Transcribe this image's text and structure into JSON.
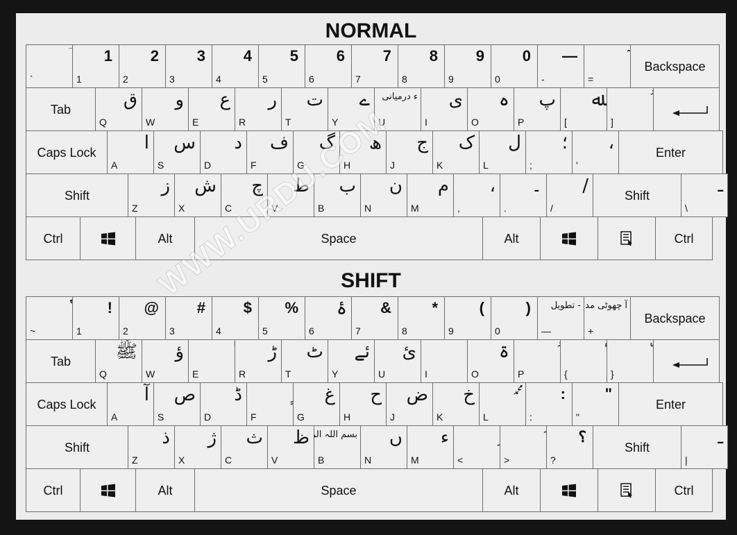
{
  "sections": [
    {
      "title": "NORMAL",
      "rows": [
        [
          {
            "name": "key-backtick",
            "latin": "`",
            "glyph": "ؔ"
          },
          {
            "name": "key-1",
            "latin": "1",
            "glyph": "1",
            "bold": true
          },
          {
            "name": "key-2",
            "latin": "2",
            "glyph": "2",
            "bold": true
          },
          {
            "name": "key-3",
            "latin": "3",
            "glyph": "3",
            "bold": true
          },
          {
            "name": "key-4",
            "latin": "4",
            "glyph": "4",
            "bold": true
          },
          {
            "name": "key-5",
            "latin": "5",
            "glyph": "5",
            "bold": true
          },
          {
            "name": "key-6",
            "latin": "6",
            "glyph": "6",
            "bold": true
          },
          {
            "name": "key-7",
            "latin": "7",
            "glyph": "7",
            "bold": true
          },
          {
            "name": "key-8",
            "latin": "8",
            "glyph": "8",
            "bold": true
          },
          {
            "name": "key-9",
            "latin": "9",
            "glyph": "9",
            "bold": true
          },
          {
            "name": "key-0",
            "latin": "0",
            "glyph": "0",
            "bold": true
          },
          {
            "name": "key-minus",
            "latin": "-",
            "glyph": "—",
            "bold": true
          },
          {
            "name": "key-equals",
            "latin": "=",
            "glyph": "ٓ"
          },
          {
            "name": "key-backspace",
            "label": "Backspace"
          }
        ],
        [
          {
            "name": "key-tab",
            "label": "Tab"
          },
          {
            "name": "key-q",
            "latin": "Q",
            "glyph": "ق"
          },
          {
            "name": "key-w",
            "latin": "W",
            "glyph": "و"
          },
          {
            "name": "key-e",
            "latin": "E",
            "glyph": "ع"
          },
          {
            "name": "key-r",
            "latin": "R",
            "glyph": "ر"
          },
          {
            "name": "key-t",
            "latin": "T",
            "glyph": "ت"
          },
          {
            "name": "key-y",
            "latin": "Y",
            "glyph": "ے"
          },
          {
            "name": "key-u",
            "latin": "U",
            "glyph": "ء درمیانی",
            "small": true
          },
          {
            "name": "key-i",
            "latin": "I",
            "glyph": "ی"
          },
          {
            "name": "key-o",
            "latin": "O",
            "glyph": "ہ"
          },
          {
            "name": "key-p",
            "latin": "P",
            "glyph": "پ"
          },
          {
            "name": "key-lbracket",
            "latin": "[",
            "glyph": "ﷲ"
          },
          {
            "name": "key-rbracket",
            "latin": "]",
            "glyph": "ُ"
          },
          {
            "name": "key-enter-top",
            "label": ""
          }
        ],
        [
          {
            "name": "key-capslock",
            "label": "Caps Lock"
          },
          {
            "name": "key-a",
            "latin": "A",
            "glyph": "ا"
          },
          {
            "name": "key-s",
            "latin": "S",
            "glyph": "س"
          },
          {
            "name": "key-d",
            "latin": "D",
            "glyph": "د"
          },
          {
            "name": "key-f",
            "latin": "F",
            "glyph": "ف"
          },
          {
            "name": "key-g",
            "latin": "G",
            "glyph": "گ"
          },
          {
            "name": "key-h",
            "latin": "H",
            "glyph": "ھ"
          },
          {
            "name": "key-j",
            "latin": "J",
            "glyph": "ج"
          },
          {
            "name": "key-k",
            "latin": "K",
            "glyph": "ک"
          },
          {
            "name": "key-l",
            "latin": "L",
            "glyph": "ل"
          },
          {
            "name": "key-semicolon",
            "latin": ";",
            "glyph": "؛"
          },
          {
            "name": "key-quote",
            "latin": "'",
            "glyph": "،"
          },
          {
            "name": "key-enter",
            "label": "Enter"
          }
        ],
        [
          {
            "name": "key-shift-left",
            "label": "Shift"
          },
          {
            "name": "key-z",
            "latin": "Z",
            "glyph": "ز"
          },
          {
            "name": "key-x",
            "latin": "X",
            "glyph": "ش"
          },
          {
            "name": "key-c",
            "latin": "C",
            "glyph": "چ"
          },
          {
            "name": "key-v",
            "latin": "V",
            "glyph": "ط"
          },
          {
            "name": "key-b",
            "latin": "B",
            "glyph": "ب"
          },
          {
            "name": "key-n",
            "latin": "N",
            "glyph": "ن"
          },
          {
            "name": "key-m",
            "latin": "M",
            "glyph": "م"
          },
          {
            "name": "key-comma",
            "latin": ",",
            "glyph": "،"
          },
          {
            "name": "key-period",
            "latin": ".",
            "glyph": "۔"
          },
          {
            "name": "key-slash",
            "latin": "/",
            "glyph": "/"
          },
          {
            "name": "key-shift-right",
            "label": "Shift"
          },
          {
            "name": "key-backslash",
            "latin": "\\",
            "glyph": "ـ"
          }
        ],
        [
          {
            "name": "key-ctrl-left",
            "label": "Ctrl"
          },
          {
            "name": "key-win-left",
            "icon": "windows-icon"
          },
          {
            "name": "key-alt-left",
            "label": "Alt"
          },
          {
            "name": "key-space",
            "label": "Space"
          },
          {
            "name": "key-alt-right",
            "label": "Alt"
          },
          {
            "name": "key-win-right",
            "icon": "windows-icon"
          },
          {
            "name": "key-menu",
            "icon": "menu-icon"
          },
          {
            "name": "key-ctrl-right",
            "label": "Ctrl"
          }
        ]
      ]
    },
    {
      "title": "SHIFT",
      "rows": [
        [
          {
            "name": "key-tilde",
            "latin": "~",
            "glyph": "ٗ"
          },
          {
            "name": "key-exclam",
            "latin": "1",
            "glyph": "!",
            "bold": true
          },
          {
            "name": "key-at",
            "latin": "2",
            "glyph": "@",
            "bold": true
          },
          {
            "name": "key-hash",
            "latin": "3",
            "glyph": "#",
            "bold": true
          },
          {
            "name": "key-dollar",
            "latin": "4",
            "glyph": "$",
            "bold": true
          },
          {
            "name": "key-percent",
            "latin": "5",
            "glyph": "%",
            "bold": true
          },
          {
            "name": "key-caret",
            "latin": "6",
            "glyph": "ۂ"
          },
          {
            "name": "key-amp",
            "latin": "7",
            "glyph": "&",
            "bold": true
          },
          {
            "name": "key-star",
            "latin": "8",
            "glyph": "*",
            "bold": true
          },
          {
            "name": "key-lparen",
            "latin": "9",
            "glyph": "(",
            "bold": true
          },
          {
            "name": "key-rparen",
            "latin": "0",
            "glyph": ")",
            "bold": true
          },
          {
            "name": "key-underscore",
            "latin": "—",
            "glyph": "تطویل -",
            "small": true
          },
          {
            "name": "key-plus",
            "latin": "+",
            "glyph": "آ چھوٹی مد",
            "small": true
          },
          {
            "name": "key-backspace",
            "label": "Backspace"
          }
        ],
        [
          {
            "name": "key-tab",
            "label": "Tab"
          },
          {
            "name": "key-q",
            "latin": "Q",
            "glyph": "ﷺ"
          },
          {
            "name": "key-w",
            "latin": "W",
            "glyph": "ؤ"
          },
          {
            "name": "key-e",
            "latin": "E",
            "glyph": "ٰ"
          },
          {
            "name": "key-r",
            "latin": "R",
            "glyph": "ڑ"
          },
          {
            "name": "key-t",
            "latin": "T",
            "glyph": "ٹ"
          },
          {
            "name": "key-y",
            "latin": "Y",
            "glyph": "ئے"
          },
          {
            "name": "key-u",
            "latin": "U",
            "glyph": "ئ"
          },
          {
            "name": "key-i",
            "latin": "I",
            "glyph": "ٖ"
          },
          {
            "name": "key-o",
            "latin": "O",
            "glyph": "ۃ"
          },
          {
            "name": "key-p",
            "latin": "P",
            "glyph": "ُ"
          },
          {
            "name": "key-lbrace",
            "latin": "{",
            "glyph": "ٔ"
          },
          {
            "name": "key-rbrace",
            "latin": "}",
            "glyph": "ّ"
          },
          {
            "name": "key-enter-top",
            "label": ""
          }
        ],
        [
          {
            "name": "key-capslock",
            "label": "Caps Lock"
          },
          {
            "name": "key-a",
            "latin": "A",
            "glyph": "آ"
          },
          {
            "name": "key-s",
            "latin": "S",
            "glyph": "ص"
          },
          {
            "name": "key-d",
            "latin": "D",
            "glyph": "ڈ"
          },
          {
            "name": "key-f",
            "latin": "F",
            "glyph": "ٍ"
          },
          {
            "name": "key-g",
            "latin": "G",
            "glyph": "غ"
          },
          {
            "name": "key-h",
            "latin": "H",
            "glyph": "ح"
          },
          {
            "name": "key-j",
            "latin": "J",
            "glyph": "ض"
          },
          {
            "name": "key-k",
            "latin": "K",
            "glyph": "خ"
          },
          {
            "name": "key-l",
            "latin": "L",
            "glyph": "ﷴ",
            "small": true
          },
          {
            "name": "key-colon",
            "latin": ":",
            "glyph": ":",
            "bold": true
          },
          {
            "name": "key-dquote",
            "latin": "\"",
            "glyph": "\"",
            "bold": true
          },
          {
            "name": "key-enter",
            "label": "Enter"
          }
        ],
        [
          {
            "name": "key-shift-left",
            "label": "Shift"
          },
          {
            "name": "key-z",
            "latin": "Z",
            "glyph": "ذ"
          },
          {
            "name": "key-x",
            "latin": "X",
            "glyph": "ژ"
          },
          {
            "name": "key-c",
            "latin": "C",
            "glyph": "ث"
          },
          {
            "name": "key-v",
            "latin": "V",
            "glyph": "ظ"
          },
          {
            "name": "key-b",
            "latin": "B",
            "glyph": "بسم اللہ الرحمٰن الرحیم",
            "small": true
          },
          {
            "name": "key-n",
            "latin": "N",
            "glyph": "ں"
          },
          {
            "name": "key-m",
            "latin": "M",
            "glyph": "ء"
          },
          {
            "name": "key-lt",
            "latin": "<",
            "glyph": "ِ"
          },
          {
            "name": "key-gt",
            "latin": ">",
            "glyph": "َ"
          },
          {
            "name": "key-question",
            "latin": "?",
            "glyph": "؟",
            "bold": true
          },
          {
            "name": "key-shift-right",
            "label": "Shift"
          },
          {
            "name": "key-pipe",
            "latin": "|",
            "glyph": "ـ"
          }
        ],
        [
          {
            "name": "key-ctrl-left",
            "label": "Ctrl"
          },
          {
            "name": "key-win-left",
            "icon": "windows-icon"
          },
          {
            "name": "key-alt-left",
            "label": "Alt"
          },
          {
            "name": "key-space",
            "label": "Space"
          },
          {
            "name": "key-alt-right",
            "label": "Alt"
          },
          {
            "name": "key-win-right",
            "icon": "windows-icon"
          },
          {
            "name": "key-menu",
            "icon": "menu-icon"
          },
          {
            "name": "key-ctrl-right",
            "label": "Ctrl"
          }
        ]
      ]
    }
  ],
  "watermark": "WWW.URDU.COM"
}
